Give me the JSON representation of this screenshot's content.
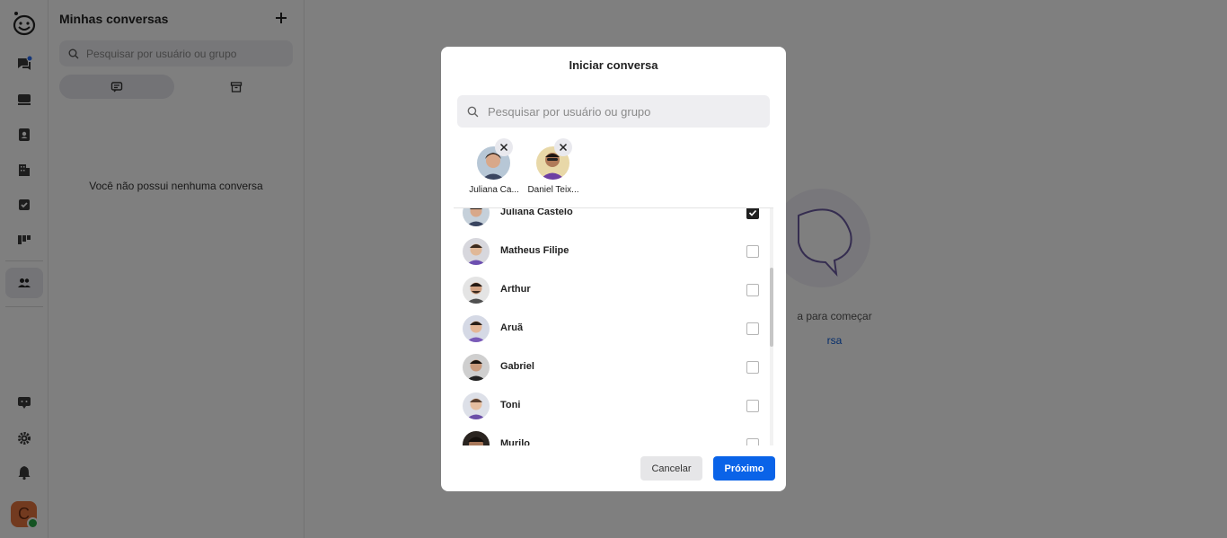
{
  "sidebar": {
    "icons": [
      "app-logo-icon",
      "chat-icon",
      "inbox-icon",
      "contacts-icon",
      "building-icon",
      "tasks-icon",
      "kanban-icon",
      "team-icon",
      "support-icon",
      "gear-icon",
      "bell-icon"
    ],
    "user_initial": "C",
    "notification_color": "#2a6cf0",
    "avatar_color": "#e4743f",
    "online_color": "#28a745"
  },
  "conversations": {
    "title": "Minhas conversas",
    "search_placeholder": "Pesquisar por usuário ou grupo",
    "empty_text": "Você não possui nenhuma conversa"
  },
  "main": {
    "hint_text": "a para começar",
    "link_text": "rsa"
  },
  "modal": {
    "title": "Iniciar conversa",
    "search_placeholder": "Pesquisar por usuário ou grupo",
    "selected": [
      {
        "name": "Juliana Ca..."
      },
      {
        "name": "Daniel Teix..."
      }
    ],
    "users": [
      {
        "name": "Juliana Castelo",
        "checked": true
      },
      {
        "name": "Matheus Filipe",
        "checked": false
      },
      {
        "name": "Arthur",
        "checked": false
      },
      {
        "name": "Aruã",
        "checked": false
      },
      {
        "name": "Gabriel",
        "checked": false
      },
      {
        "name": "Toni",
        "checked": false
      },
      {
        "name": "Murilo",
        "checked": false
      }
    ],
    "cancel_label": "Cancelar",
    "next_label": "Próximo",
    "primary_color": "#0a63e8"
  }
}
